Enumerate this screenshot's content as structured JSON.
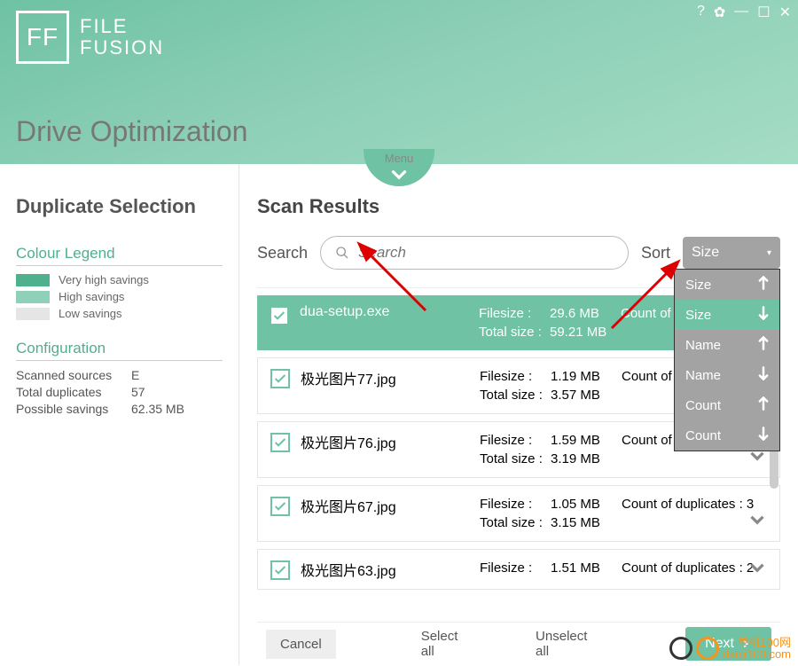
{
  "app": {
    "name1": "FILE",
    "name2": "FUSION",
    "logo": "FF"
  },
  "page_title": "Drive Optimization",
  "menu_label": "Menu",
  "sidebar": {
    "title": "Duplicate Selection",
    "legend_title": "Colour Legend",
    "legend": [
      {
        "color": "#4fb08d",
        "label": "Very high savings"
      },
      {
        "color": "#8fd0b8",
        "label": "High savings"
      },
      {
        "color": "#e5e5e5",
        "label": "Low savings"
      }
    ],
    "config_title": "Configuration",
    "config": [
      {
        "k": "Scanned sources",
        "v": "E"
      },
      {
        "k": "Total duplicates",
        "v": "57"
      },
      {
        "k": "Possible savings",
        "v": "62.35 MB"
      }
    ]
  },
  "content": {
    "title": "Scan Results",
    "search_label": "Search",
    "search_placeholder": "Search",
    "sort_label": "Sort",
    "sort_selected": "Size",
    "sort_options": [
      {
        "label": "Size",
        "dir": "up"
      },
      {
        "label": "Size",
        "dir": "down",
        "selected": true
      },
      {
        "label": "Name",
        "dir": "up"
      },
      {
        "label": "Name",
        "dir": "down"
      },
      {
        "label": "Count",
        "dir": "up"
      },
      {
        "label": "Count",
        "dir": "down"
      }
    ],
    "rows": [
      {
        "name": "dua-setup.exe",
        "filesize": "29.6 MB",
        "total": "59.21 MB",
        "count_label": "Count of dup",
        "selected": true
      },
      {
        "name": "极光图片77.jpg",
        "filesize": "1.19 MB",
        "total": "3.57 MB",
        "count_label": "Count of dup"
      },
      {
        "name": "极光图片76.jpg",
        "filesize": "1.59 MB",
        "total": "3.19 MB",
        "count_label": "Count of dup"
      },
      {
        "name": "极光图片67.jpg",
        "filesize": "1.05 MB",
        "total": "3.15 MB",
        "count_label": "Count of duplicates : 3"
      },
      {
        "name": "极光图片63.jpg",
        "filesize": "1.51 MB",
        "total": "",
        "count_label": "Count of duplicates : 2"
      }
    ],
    "labels": {
      "filesize": "Filesize :",
      "totalsize": "Total size :"
    }
  },
  "footer": {
    "cancel": "Cancel",
    "select_all": "Select all",
    "unselect_all": "Unselect all",
    "next": "Next"
  },
  "watermark": {
    "line1": "单机100网",
    "line2": "danji100.com"
  }
}
